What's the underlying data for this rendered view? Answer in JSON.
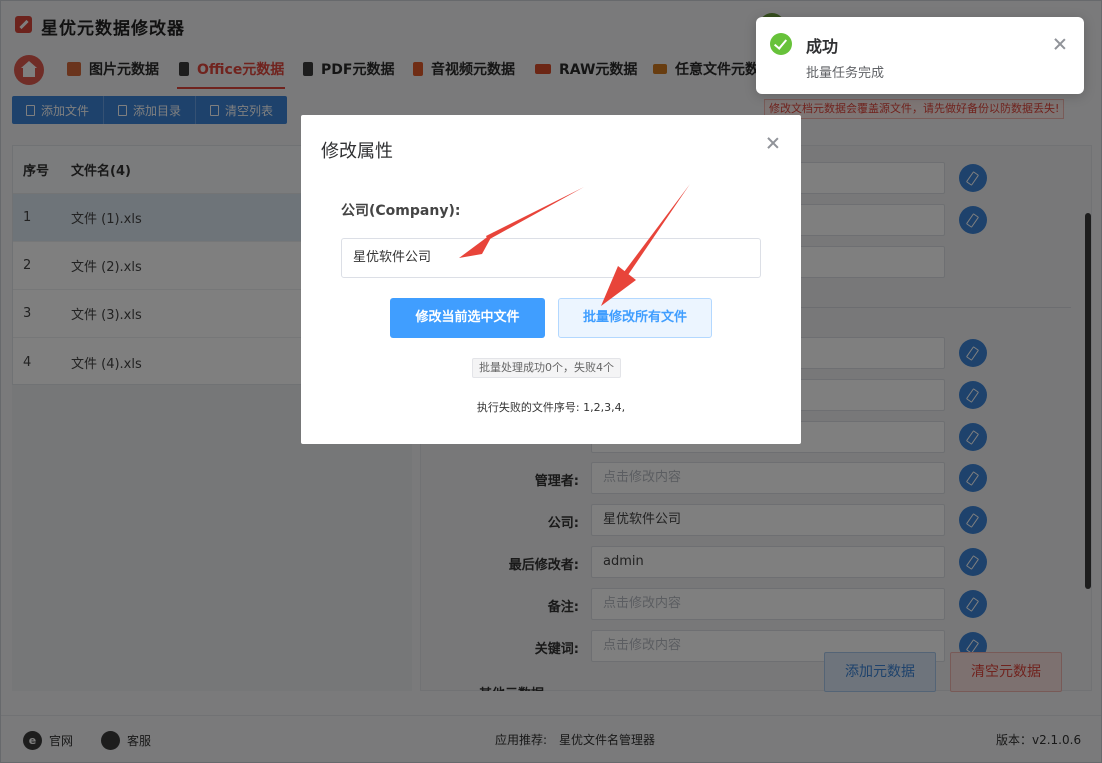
{
  "app": {
    "title": "星优元数据修改器"
  },
  "tabs": [
    {
      "label": "图片元数据",
      "icon": "image-meta-icon",
      "color": "#d5683a"
    },
    {
      "label": "Office元数据",
      "icon": "office-meta-icon",
      "color": "#c44a2b"
    },
    {
      "label": "PDF元数据",
      "icon": "pdf-meta-icon",
      "color": "#3a3a3a"
    },
    {
      "label": "音视频元数据",
      "icon": "media-meta-icon",
      "color": "#e05a2a"
    },
    {
      "label": "RAW元数据",
      "icon": "raw-meta-icon",
      "color": "#d84c2a"
    },
    {
      "label": "任意文件元数",
      "icon": "any-file-meta-icon",
      "color": "#d07a20"
    }
  ],
  "toolbar": {
    "add_file": "添加文件",
    "add_dir": "添加目录",
    "clear_list": "清空列表"
  },
  "warning": "修改文档元数据会覆盖源文件，请先做好备份以防数据丢失!",
  "table": {
    "col_index": "序号",
    "col_name": "文件名(4)",
    "rows": [
      {
        "index": "1",
        "name": "文件 (1).xls"
      },
      {
        "index": "2",
        "name": "文件 (2).xls"
      },
      {
        "index": "3",
        "name": "文件 (3).xls"
      },
      {
        "index": "4",
        "name": "文件 (4).xls"
      }
    ]
  },
  "form": {
    "fields": [
      {
        "label": "管理者:",
        "value": "点击修改内容",
        "placeholder": true
      },
      {
        "label": "公司:",
        "value": "星优软件公司",
        "placeholder": false
      },
      {
        "label": "最后修改者:",
        "value": "admin",
        "placeholder": false
      },
      {
        "label": "备注:",
        "value": "点击修改内容",
        "placeholder": true
      },
      {
        "label": "关键词:",
        "value": "点击修改内容",
        "placeholder": true
      }
    ],
    "add_meta": "添加元数据",
    "clear_meta": "清空元数据",
    "other_meta": "其他元数据"
  },
  "status": {
    "website": "官网",
    "support": "客服",
    "recommend_label": "应用推荐:",
    "recommend_app": "星优文件名管理器",
    "version": "版本：v2.1.0.6"
  },
  "modal": {
    "title": "修改属性",
    "field_label": "公司(Company):",
    "field_value": "星优软件公司",
    "btn_modify_current": "修改当前选中文件",
    "btn_batch_modify": "批量修改所有文件",
    "result": "批量处理成功0个，失败4个",
    "fail_text": "执行失败的文件序号: 1,2,3,4,"
  },
  "toast": {
    "title": "成功",
    "message": "批量任务完成"
  },
  "colors": {
    "brand_red": "#e0463c",
    "primary_blue": "#409eff",
    "toolbar_blue": "#3c85d8",
    "success_green": "#67c23a",
    "arrow_red": "#e8443a"
  }
}
